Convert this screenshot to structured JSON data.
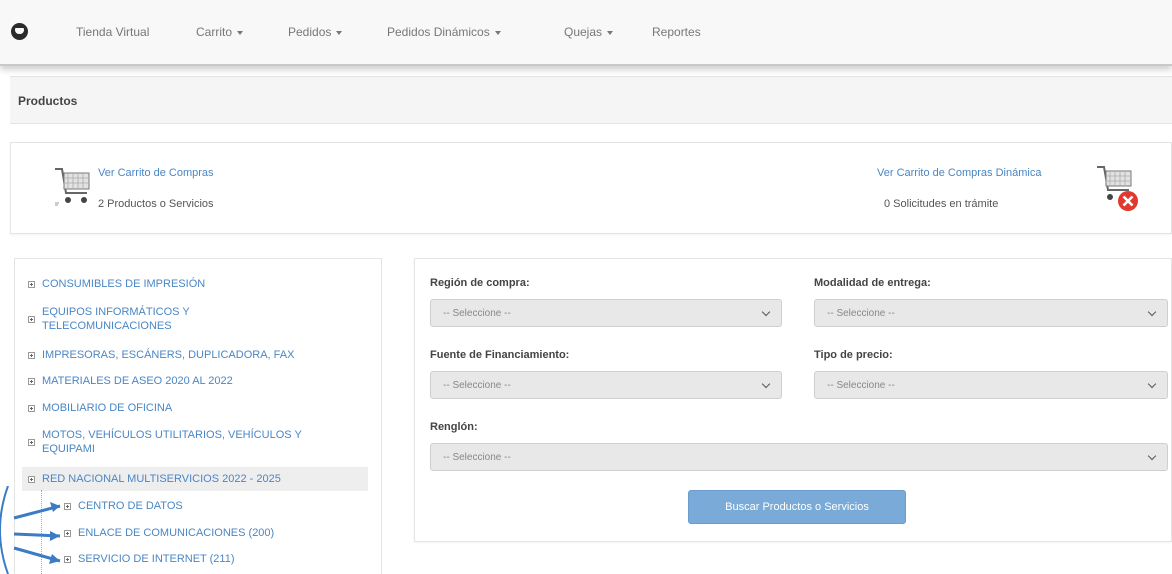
{
  "navbar": {
    "brand_icon": "cart-circle-icon",
    "items": [
      {
        "label": "Tienda Virtual",
        "dropdown": false
      },
      {
        "label": "Carrito",
        "dropdown": true
      },
      {
        "label": "Pedidos",
        "dropdown": true
      },
      {
        "label": "Pedidos Dinámicos",
        "dropdown": true
      },
      {
        "label": "Quejas",
        "dropdown": true
      },
      {
        "label": "Reportes",
        "dropdown": false
      }
    ]
  },
  "page": {
    "title": "Productos"
  },
  "cart": {
    "link": "Ver Carrito de Compras",
    "count": "2 Productos o Servicios",
    "dynamic_link": "Ver Carrito de Compras Dinámica",
    "dynamic_count": "0 Solicitudes en trámite"
  },
  "tree": {
    "items": [
      {
        "label": "CONSUMIBLES DE IMPRESIÓN"
      },
      {
        "label": "EQUIPOS INFORMÁTICOS Y",
        "label2": "TELECOMUNICACIONES"
      },
      {
        "label": "IMPRESORAS, ESCÁNERS, DUPLICADORA, FAX"
      },
      {
        "label": "MATERIALES DE ASEO 2020 AL 2022"
      },
      {
        "label": "MOBILIARIO DE OFICINA"
      },
      {
        "label": "MOTOS, VEHÍCULOS UTILITARIOS, VEHÍCULOS Y",
        "label2": "EQUIPAMI"
      },
      {
        "label": "RED NACIONAL MULTISERVICIOS 2022 - 2025"
      }
    ],
    "children": [
      {
        "label": "CENTRO DE DATOS"
      },
      {
        "label": "ENLACE DE COMUNICACIONES (200)"
      },
      {
        "label": "SERVICIO DE INTERNET (211)"
      }
    ]
  },
  "filters": {
    "region_label": "Región de compra:",
    "region_value": "-- Seleccione --",
    "modalidad_label": "Modalidad de entrega:",
    "modalidad_value": "-- Seleccione --",
    "fuente_label": "Fuente de Financiamiento:",
    "fuente_value": "-- Seleccione --",
    "tipo_label": "Tipo de precio:",
    "tipo_value": "-- Seleccione --",
    "renglon_label": "Renglón:",
    "renglon_value": "-- Seleccione --",
    "search_button": "Buscar Productos o Servicios"
  },
  "colors": {
    "link": "#4a86c5",
    "button": "#7aaad8",
    "annotation": "#3b7cc4",
    "remove": "#e03a2f"
  }
}
